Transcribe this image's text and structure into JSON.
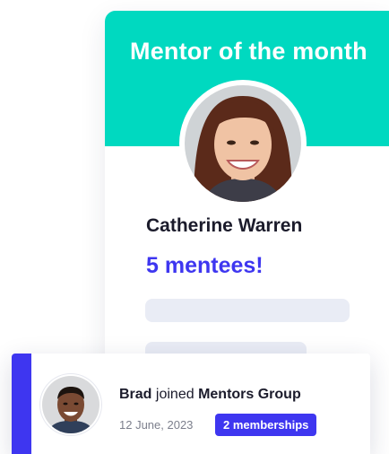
{
  "mentor_card": {
    "title": "Mentor of the month",
    "name": "Catherine Warren",
    "mentees": "5 mentees!"
  },
  "activity": {
    "user": "Brad",
    "action": "joined",
    "group": "Mentors Group",
    "date": "12 June, 2023",
    "badge": "2 memberships"
  },
  "colors": {
    "header": "#00d9c0",
    "accent": "#3e36f0",
    "placeholder": "#e9ecf5"
  }
}
